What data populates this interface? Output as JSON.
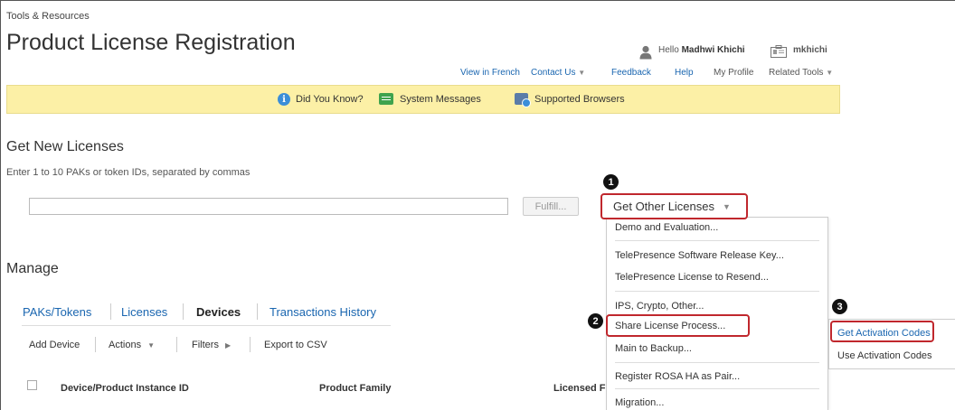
{
  "breadcrumb": "Tools & Resources",
  "page_title": "Product License Registration",
  "user": {
    "greeting_prefix": "Hello",
    "name": "Madhwi Khichi",
    "user_id": "mkhichi",
    "icons": {
      "user": "user-icon",
      "id": "id-card-icon"
    }
  },
  "top_nav": {
    "view_in_french": "View in French",
    "contact_us": "Contact Us",
    "feedback": "Feedback",
    "help": "Help",
    "my_profile": "My Profile",
    "related_tools": "Related Tools",
    "caret": "▼"
  },
  "banner": {
    "did_you_know": "Did You Know?",
    "system_messages": "System Messages",
    "supported_browsers": "Supported Browsers",
    "info_glyph": "i",
    "background": "#fcf0a6"
  },
  "get_new_licenses": {
    "title": "Get New Licenses",
    "helper": "Enter 1 to 10 PAKs or token IDs, separated by commas",
    "input_value": "",
    "fulfill_label": "Fulfill..."
  },
  "get_other_licenses": {
    "label": "Get Other Licenses",
    "caret": "▼",
    "menu_items": [
      "Demo and Evaluation...",
      "TelePresence Software Release Key...",
      "TelePresence License to Resend...",
      "IPS, Crypto, Other...",
      "Share License Process...",
      "Main to Backup...",
      "Register ROSA HA as Pair...",
      "Migration..."
    ],
    "submenu_items": [
      "Get Activation Codes",
      "Use Activation Codes"
    ]
  },
  "manage": {
    "title": "Manage",
    "tabs": [
      {
        "label": "PAKs/Tokens",
        "active": false
      },
      {
        "label": "Licenses",
        "active": false
      },
      {
        "label": "Devices",
        "active": true
      },
      {
        "label": "Transactions History",
        "active": false
      }
    ],
    "actions": {
      "add_device": "Add Device",
      "actions": "Actions",
      "actions_caret": "▼",
      "filters": "Filters",
      "filters_caret": "▶",
      "export": "Export to CSV"
    },
    "columns": [
      "Device/Product Instance ID",
      "Product Family",
      "Licensed F"
    ]
  },
  "annotations": {
    "step1": "1",
    "step2": "2",
    "step3": "3",
    "highlight_color": "#c0272d"
  },
  "colors": {
    "link_blue": "#1a66b0",
    "banner_yellow": "#fcf0a6",
    "annotation_red": "#c0272d"
  }
}
